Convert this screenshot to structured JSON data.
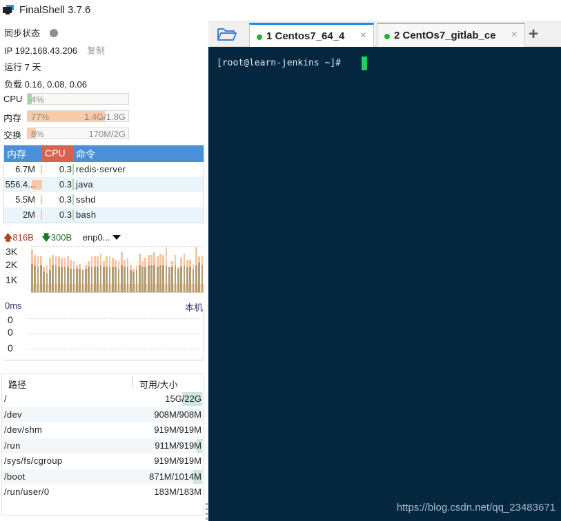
{
  "app": {
    "title": "FinalShell 3.7.6"
  },
  "sidebar": {
    "sync_label": "同步状态",
    "ip_label": "IP 192.168.43.206",
    "copy_label": "复制",
    "uptime": "运行 7 天",
    "load": "负载 0.16, 0.08, 0.06",
    "meters": [
      {
        "label": "CPU",
        "percent_text": "4%",
        "percent": 4,
        "amount": "",
        "color": "#9fd6a3"
      },
      {
        "label": "内存",
        "percent_text": "77%",
        "percent": 77,
        "amount": "1.4G/1.8G",
        "color": "#f9cba8"
      },
      {
        "label": "交换",
        "percent_text": "8%",
        "percent": 8,
        "amount": "170M/2G",
        "color": "#f9cba8"
      }
    ],
    "process_table": {
      "headers": {
        "mem": "内存",
        "cpu": "CPU",
        "cmd": "命令"
      },
      "rows": [
        {
          "mem": "6.7M",
          "cpu": "0.3",
          "cmd": "redis-server"
        },
        {
          "mem": "556.4...",
          "cpu": "0.3",
          "cmd": "java"
        },
        {
          "mem": "5.5M",
          "cpu": "0.3",
          "cmd": "sshd"
        },
        {
          "mem": "2M",
          "cpu": "0.3",
          "cmd": "bash"
        }
      ]
    },
    "network": {
      "up_icon": "arrow-up-icon",
      "up": "816B",
      "down_icon": "arrow-down-icon",
      "down": "300B",
      "interface": "enp0...",
      "y_labels": [
        "3K",
        "2K",
        "1K"
      ],
      "y_max": 3200,
      "colors": {
        "upload": "#f6c3a3",
        "download": "#a8956a",
        "baseline": "#f3c7a7"
      },
      "upload_series": [
        2900,
        2500,
        2400,
        2400,
        1700,
        1800,
        2300,
        2500,
        2400,
        2400,
        2300,
        2300,
        2400,
        2200,
        2100,
        1800,
        1900,
        1600,
        1800,
        2100,
        2400,
        2400,
        2400,
        2600,
        2100,
        2400,
        2400,
        2300,
        2200,
        2100,
        2700,
        2200,
        2300,
        1800,
        1600,
        1800,
        2600,
        2100,
        2300,
        2500,
        2500,
        2700,
        2400,
        2600,
        2500,
        3000,
        1300,
        2100,
        2500,
        1700,
        2300,
        2600,
        2200,
        2200,
        1900,
        3000,
        2400,
        2400
      ],
      "download_series": [
        1900,
        1800,
        1700,
        1800,
        1400,
        1300,
        1500,
        1800,
        1800,
        1700,
        1700,
        1700,
        1700,
        1600,
        1600,
        1600,
        1600,
        1500,
        1600,
        1700,
        1700,
        1700,
        1700,
        1800,
        1700,
        1700,
        1700,
        1700,
        1700,
        1600,
        1800,
        1700,
        1700,
        1500,
        1400,
        1500,
        1800,
        1700,
        1700,
        1800,
        1800,
        1800,
        1700,
        1800,
        1800,
        1800,
        1700,
        1700,
        1800,
        1600,
        1700,
        1800,
        1700,
        1700,
        1600,
        1800,
        2000,
        1800
      ]
    },
    "ping": {
      "latency": "0ms",
      "target": "本机",
      "values": [
        "0",
        "0",
        "0"
      ]
    },
    "disk_table": {
      "headers": {
        "path": "路径",
        "size": "可用/大小"
      },
      "rows": [
        {
          "path": "/",
          "size": "15G/22G",
          "used_fraction": 0.32
        },
        {
          "path": "/dev",
          "size": "908M/908M",
          "used_fraction": 0
        },
        {
          "path": "/dev/shm",
          "size": "919M/919M",
          "used_fraction": 0
        },
        {
          "path": "/run",
          "size": "911M/919M",
          "used_fraction": 0.01
        },
        {
          "path": "/sys/fs/cgroup",
          "size": "919M/919M",
          "used_fraction": 0
        },
        {
          "path": "/boot",
          "size": "871M/1014M",
          "used_fraction": 0.14
        },
        {
          "path": "/run/user/0",
          "size": "183M/183M",
          "used_fraction": 0
        }
      ]
    }
  },
  "tabs": {
    "folder_icon": "folder-icon",
    "items": [
      {
        "label": "1 Centos7_64_4",
        "active": true,
        "status_color": "#22b33a"
      },
      {
        "label": "2 CentOs7_gitlab_ce",
        "active": false,
        "status_color": "#22b33a"
      }
    ],
    "close_glyph": "×",
    "add_glyph": "+"
  },
  "terminal": {
    "prompt": "[root@learn-jenkins ~]#",
    "cursor_color": "#1fd05a",
    "background": "#04263f"
  },
  "watermark": "https://blog.csdn.net/qq_23483671"
}
